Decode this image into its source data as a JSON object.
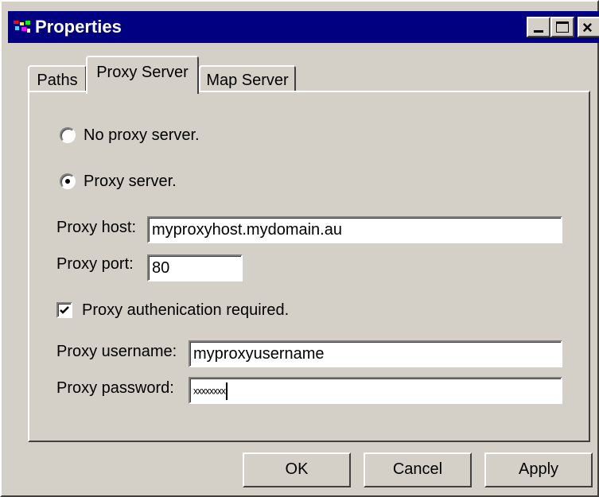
{
  "window": {
    "title": "Properties",
    "controls": {
      "minimize": "minimize-icon",
      "maximize": "maximize-icon",
      "close": "close-icon"
    }
  },
  "tabs": [
    {
      "label": "Paths",
      "selected": false
    },
    {
      "label": "Proxy Server",
      "selected": true
    },
    {
      "label": "Map Server",
      "selected": false
    }
  ],
  "proxy": {
    "no_proxy_label": "No proxy server.",
    "no_proxy_selected": false,
    "proxy_label": "Proxy server.",
    "proxy_selected": true,
    "host_label": "Proxy host:",
    "host_value": "myproxyhost.mydomain.au",
    "port_label": "Proxy port:",
    "port_value": "80",
    "auth_label": "Proxy authenication required.",
    "auth_checked": true,
    "username_label": "Proxy username:",
    "username_value": "myproxyusername",
    "password_label": "Proxy password:",
    "password_value": "xxxxxxxx"
  },
  "buttons": {
    "ok": "OK",
    "cancel": "Cancel",
    "apply": "Apply"
  },
  "colors": {
    "titlebar": "#000080",
    "face": "#d4d0c8",
    "field": "#ffffff"
  }
}
